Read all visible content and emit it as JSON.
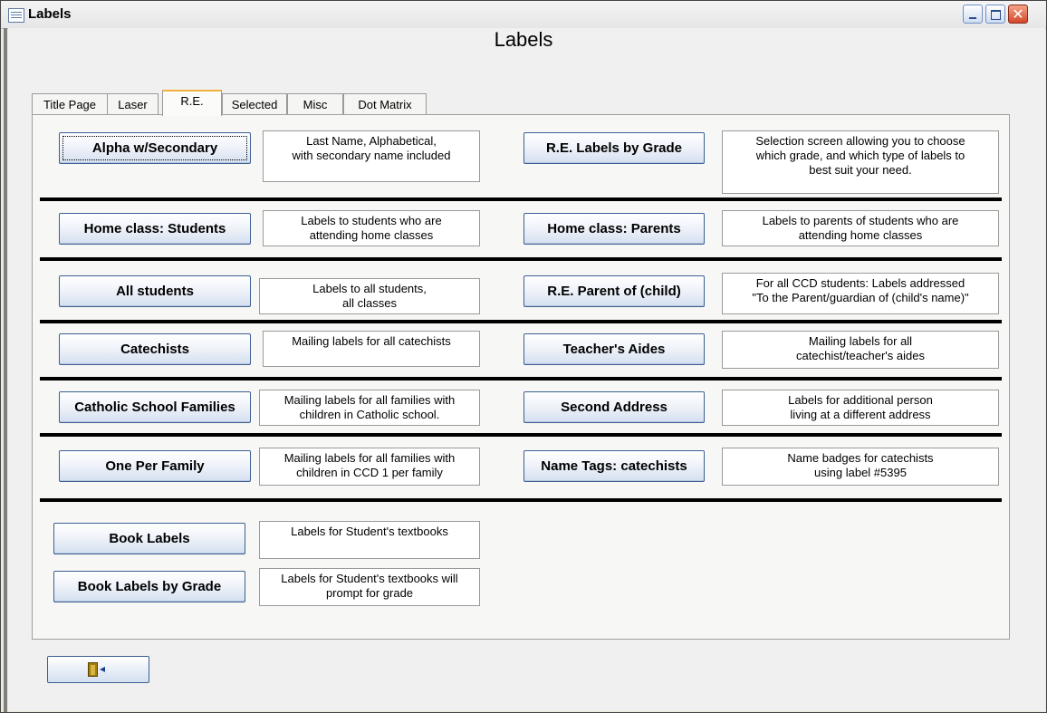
{
  "window": {
    "title": "Labels"
  },
  "form": {
    "title": "Labels"
  },
  "tabs": [
    {
      "label": "Title Page",
      "active": false
    },
    {
      "label": "Laser",
      "active": false
    },
    {
      "label": "R.E.",
      "active": true
    },
    {
      "label": "Selected",
      "active": false
    },
    {
      "label": "Misc",
      "active": false
    },
    {
      "label": "Dot Matrix",
      "active": false
    }
  ],
  "left_column": [
    {
      "button": "Alpha w/Secondary",
      "description": "Last Name, Alphabetical,\nwith secondary name included"
    },
    {
      "button": "Home class: Students",
      "description": "Labels to students who are\nattending home classes"
    },
    {
      "button": "All students",
      "description": "Labels to all students,\nall classes"
    },
    {
      "button": "Catechists",
      "description": "Mailing labels for all catechists"
    },
    {
      "button": "Catholic School Families",
      "description": "Mailing labels for all families with\nchildren in Catholic school."
    },
    {
      "button": "One Per Family",
      "description": "Mailing labels for all families with\nchildren in CCD 1 per family"
    }
  ],
  "right_column": [
    {
      "button": "R.E. Labels by Grade",
      "description": "Selection screen allowing you to choose\nwhich grade, and which type of labels to\nbest suit your need."
    },
    {
      "button": "Home class: Parents",
      "description": "Labels to parents of students who are\nattending home classes"
    },
    {
      "button": "R.E. Parent of (child)",
      "description": "For all CCD students: Labels addressed\n\"To the Parent/guardian of (child's name)\""
    },
    {
      "button": "Teacher's Aides",
      "description": "Mailing labels for all\ncatechist/teacher's aides"
    },
    {
      "button": "Second Address",
      "description": "Labels for additional person\nliving at a different address"
    },
    {
      "button": "Name Tags: catechists",
      "description": "Name badges for catechists\nusing label #5395"
    }
  ],
  "bottom": [
    {
      "button": "Book Labels",
      "description": "Labels for Student's textbooks"
    },
    {
      "button": "Book Labels by Grade",
      "description": "Labels for Student's textbooks will\nprompt for grade"
    }
  ],
  "icons": {
    "app": "form-icon",
    "exit": "exit-door-icon",
    "close_glyph": "✕"
  },
  "colors": {
    "active_tab_accent": "#f2b13f",
    "button_border": "#3d5f93",
    "close_red": "#d4472a"
  }
}
